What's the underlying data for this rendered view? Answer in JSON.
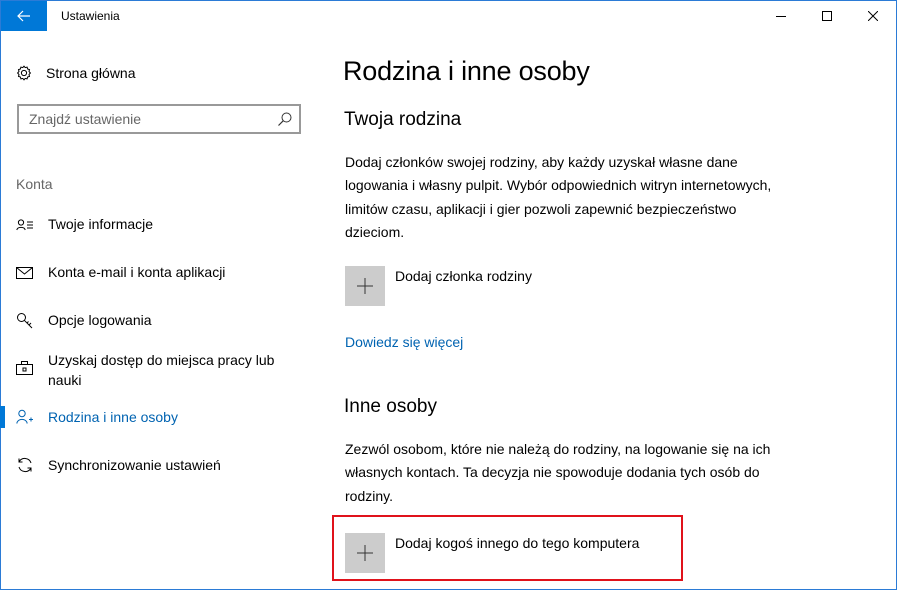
{
  "window": {
    "title": "Ustawienia",
    "accent_color": "#0078d7",
    "highlight_color": "#e0121b"
  },
  "titlebar": {
    "back_icon": "arrow-left-icon",
    "minimize_icon": "minimize-icon",
    "maximize_icon": "maximize-icon",
    "close_icon": "close-icon"
  },
  "sidebar": {
    "home_label": "Strona główna",
    "home_icon": "gear-icon",
    "search_placeholder": "Znajdź ustawienie",
    "section_label": "Konta",
    "items": [
      {
        "label": "Twoje informacje",
        "icon": "person-card-icon",
        "selected": false
      },
      {
        "label": "Konta e-mail i konta aplikacji",
        "icon": "mail-icon",
        "selected": false
      },
      {
        "label": "Opcje logowania",
        "icon": "key-icon",
        "selected": false
      },
      {
        "label": "Uzyskaj dostęp do miejsca pracy lub nauki",
        "icon": "briefcase-icon",
        "selected": false
      },
      {
        "label": "Rodzina i inne osoby",
        "icon": "people-icon",
        "selected": true
      },
      {
        "label": "Synchronizowanie ustawień",
        "icon": "sync-icon",
        "selected": false
      }
    ]
  },
  "main": {
    "title": "Rodzina i inne osoby",
    "family": {
      "heading": "Twoja rodzina",
      "description": "Dodaj członków swojej rodziny, aby każdy uzyskał własne dane logowania i własny pulpit. Wybór odpowiednich witryn internetowych, limitów czasu, aplikacji i gier pozwoli zapewnić bezpieczeństwo dzieciom.",
      "add_label": "Dodaj członka rodziny",
      "learn_more": "Dowiedz się więcej"
    },
    "others": {
      "heading": "Inne osoby",
      "description": "Zezwól osobom, które nie należą do rodziny, na logowanie się na ich własnych kontach. Ta decyzja nie spowoduje dodania tych osób do rodziny.",
      "add_label": "Dodaj kogoś innego do tego komputera"
    }
  }
}
